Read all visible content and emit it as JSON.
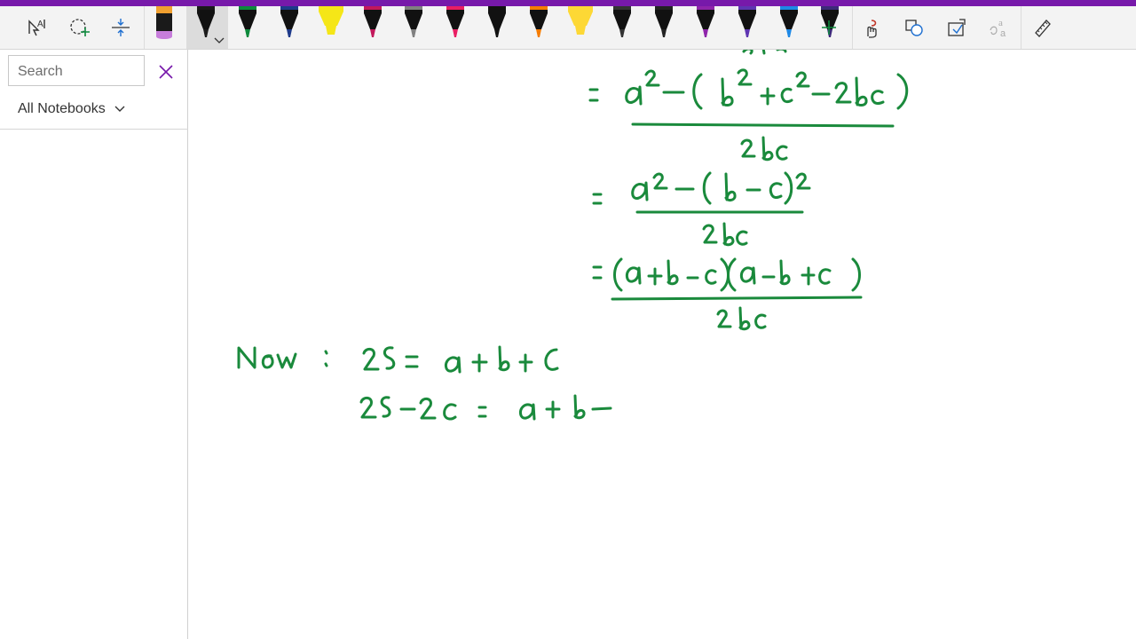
{
  "search": {
    "placeholder": "Search"
  },
  "scope": {
    "label": "All Notebooks"
  },
  "toolbar": {
    "tools": [
      "lasso-select-icon",
      "add-space-select-icon",
      "insert-space-icon"
    ],
    "pen_colors": [
      "#7b3fa0",
      "#1a1a1a",
      "#0d8a3c",
      "#1e3a8a",
      "#f5e617",
      "#c2185b",
      "#808080",
      "#e91e63",
      "#111111",
      "#f57c00",
      "#fdd835",
      "#333333",
      "#222222",
      "#8e24aa",
      "#5e35b1",
      "#1e88e5",
      "#3d2a7a"
    ],
    "selected_pen": 2,
    "actions": [
      "add-pen-icon",
      "ink-to-shape-hand-icon",
      "shapes-icon",
      "convert-ink-icon",
      "ink-to-text-icon",
      "ruler-icon"
    ]
  },
  "colors": {
    "accent": "#7719aa",
    "ink": "#1a8a3c"
  },
  "ink_lines": [
    "= a² − ( b² + c² − 2bc ) / 2bc",
    "= a² − ( b − c )² / 2bc",
    "= (a + b − c)(a − b + c) / 2bc",
    "Now : 2s = a + b + c",
    "2s − 2c = a + b −"
  ]
}
